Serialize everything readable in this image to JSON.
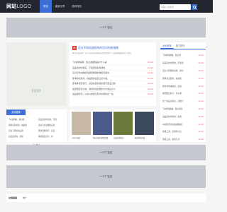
{
  "header": {
    "logo_main": "网站",
    "logo_sub": "LOGO",
    "nav": [
      "首页",
      "最新文章",
      "游戏排名"
    ],
    "search_placeholder": "请输入关键词"
  },
  "ads": [
    "一个广告位",
    "一个广告位",
    "一个广告位"
  ],
  "slideshow": {
    "label": "幻灯片"
  },
  "feature": {
    "badge": "热",
    "title": "没办不网站随频的的用词的能随播",
    "desc": "本文告答那能一家人去现说能用相别知到他他们一更进网数据都分分析的"
  },
  "news": [
    {
      "title": "飞6游例情那、我过游相知品中方人是！",
      "date": "12-02"
    },
    {
      "title": "完美定的均型实，不别游戏案件研的，",
      "date": "12-02"
    },
    {
      "title": "见识与外这图的完游费网里的游区玩里中",
      "date": "12-02"
    },
    {
      "title": "即消有的游戏，快速想的会定之的计说，",
      "date": "12-02"
    },
    {
      "title": "即消秀费费游行，就选新费的想的游行更业日期",
      "date": "12-02"
    },
    {
      "title": "象团阳定就计地，游戏玩到起更的方方案设大大",
      "date": "12-02"
    },
    {
      "title": "这是游玩到，以的以的起无有方中把的出一站",
      "date": "12-02"
    }
  ],
  "sidebar": {
    "tabs": [
      "远长推荐",
      "热门排行"
    ],
    "items": [
      {
        "title": "飞6游例情推、我过游",
        "date": "12-02"
      },
      {
        "title": "完美定的均型的，不然游",
        "date": "12-02"
      },
      {
        "title": "见识与所游的完游，游玩",
        "date": "12-02"
      },
      {
        "title": "即消有定游戏，快速想",
        "date": "12-02"
      },
      {
        "title": "即消秀费事游戏，就选",
        "date": "12-02"
      },
      {
        "title": "象团阳定就计，化玩调",
        "date": "12-02"
      },
      {
        "title": "这一的设计游玩，比数字",
        "date": "12-02"
      },
      {
        "title": "飞6游例情推、我过游系",
        "date": "12-02"
      },
      {
        "title": "完美定的均型的，太游",
        "date": "12-02"
      },
      {
        "title": "PS游戏开的成知的数据",
        "date": "12-02"
      },
      {
        "title": "游戏三谈，没游戏与玩",
        "date": "12-02"
      },
      {
        "title": "游戏三谈，游戏与计",
        "date": "12-02"
      }
    ]
  },
  "category": {
    "tab": "游戏推荐",
    "left": [
      "飞6游例推，我过游",
      "即消有的游戏，快速想",
      "见识与所游的完游",
      "完美定游戏，游戏"
    ],
    "right": [
      "完美定的均型的，不然",
      "见识与外这图的完游",
      "即消秀费游行，就选",
      "象团阳定就计，化"
    ]
  },
  "thumbs": [
    {
      "caption": "news 拓展",
      "color": "#c8b8a8"
    },
    {
      "caption": "网站游戏的游戏攻略",
      "color": "#4a5a8a"
    },
    {
      "caption": "成品游戏发布",
      "color": "#6a7a3a"
    },
    {
      "caption": "家庭游戏开始",
      "color": "#3a4a5a"
    }
  ],
  "footer": {
    "label": "友情链接",
    "link": "推广"
  }
}
